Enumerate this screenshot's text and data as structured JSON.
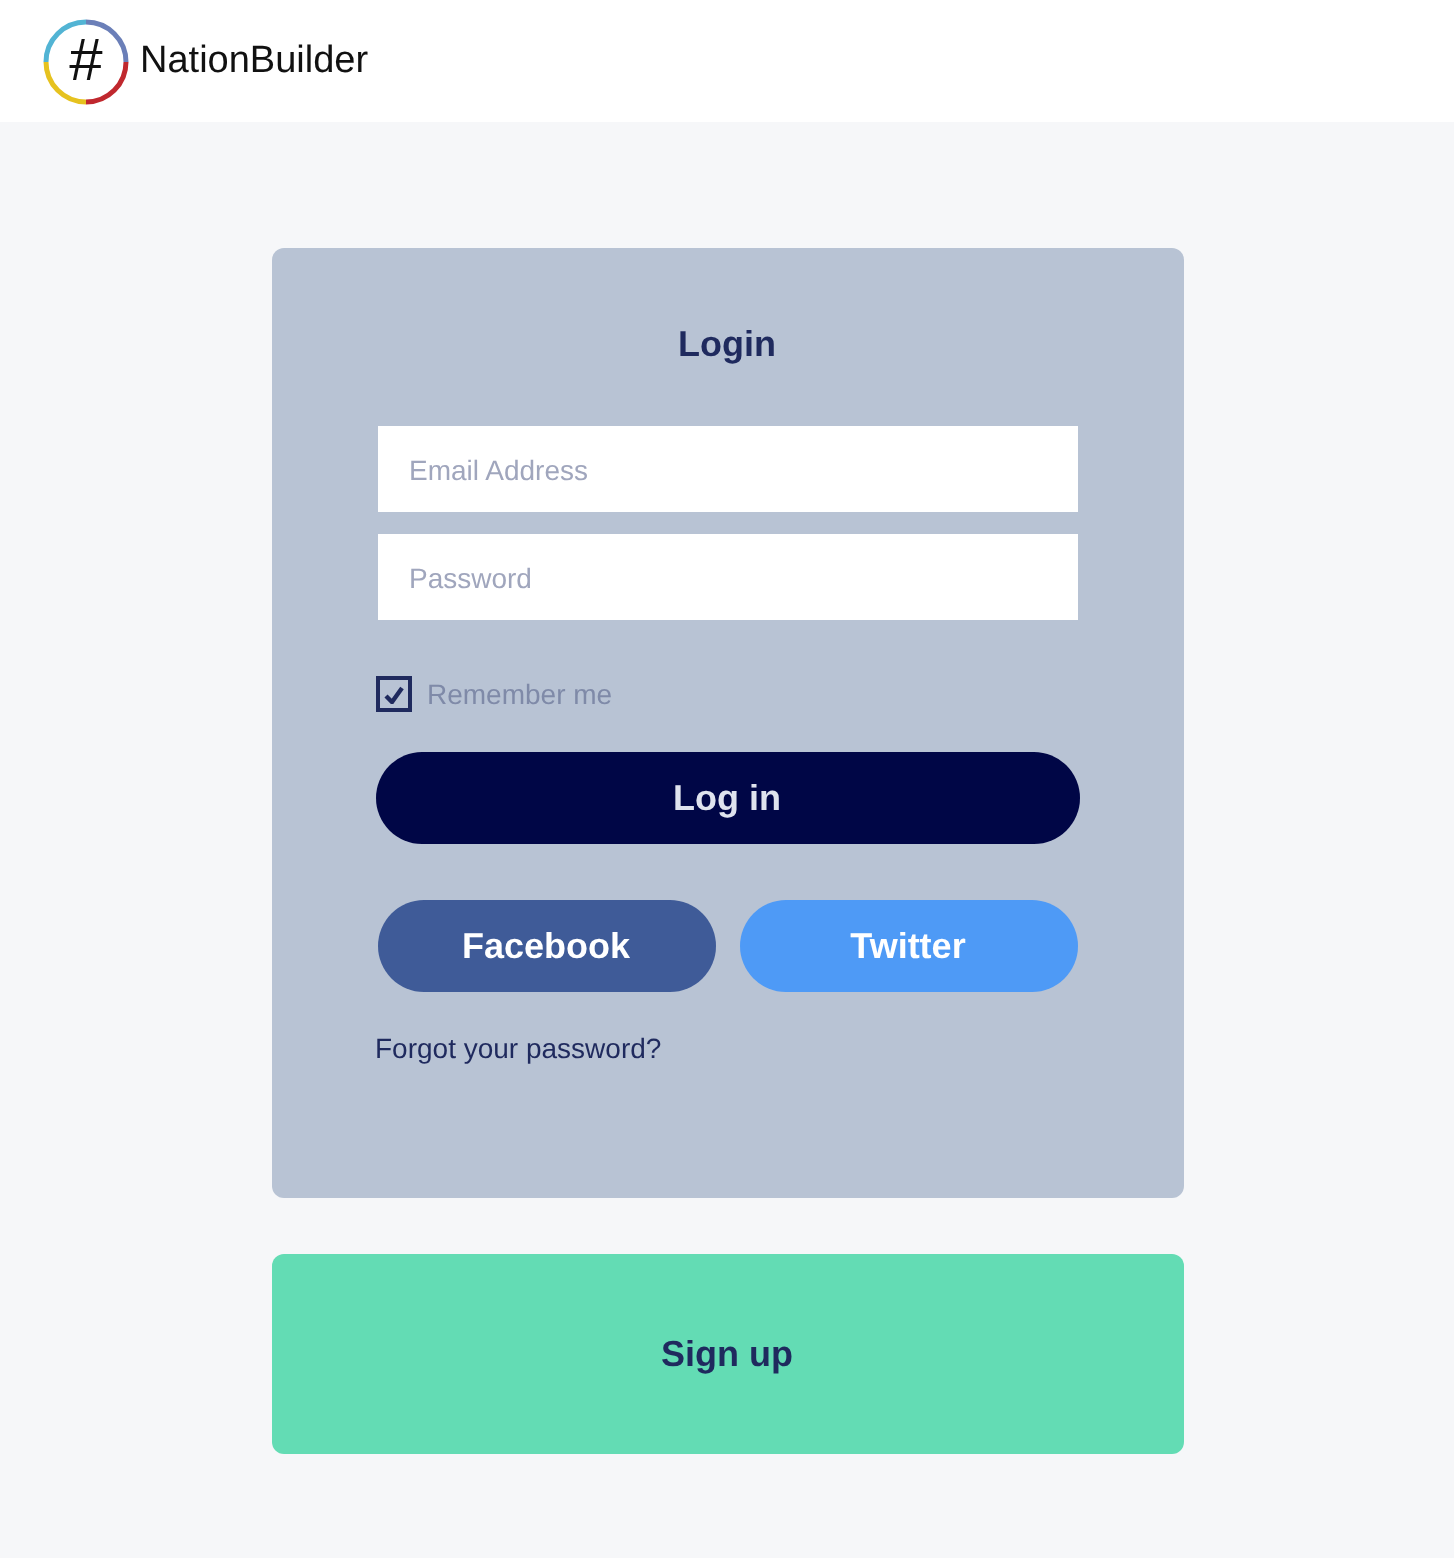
{
  "header": {
    "logo_symbol": "#",
    "brand": "NationBuilder"
  },
  "login": {
    "title": "Login",
    "email": {
      "placeholder": "Email Address"
    },
    "password": {
      "placeholder": "Password"
    },
    "remember": {
      "label": "Remember me",
      "checked": true
    },
    "login_button": "Log in",
    "social_buttons": [
      {
        "label": "Facebook",
        "color": "#3f5b98"
      },
      {
        "label": "Twitter",
        "color": "#4e9af6"
      }
    ],
    "forgot_link": "Forgot your password?"
  },
  "signup_button": "Sign up"
}
